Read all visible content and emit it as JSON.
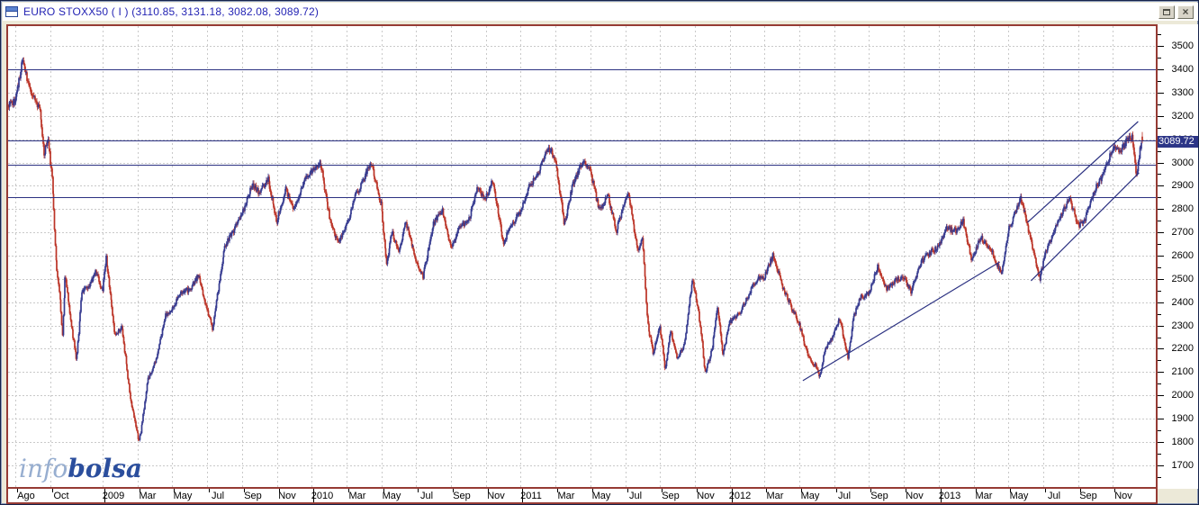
{
  "window": {
    "title": "EURO STOXX50 ( I ) (3110.85, 3131.18, 3082.08, 3089.72)",
    "restore_button": "restore",
    "close_button": "close"
  },
  "watermark": {
    "info": "info",
    "bolsa": "bolsa"
  },
  "price_tag": {
    "value": "3089.72"
  },
  "chart_data": {
    "type": "ohlc-candlestick",
    "title": "EURO STOXX50 ( I ) daily",
    "last_bar": {
      "open": 3110.85,
      "high": 3131.18,
      "low": 3082.08,
      "close": 3089.72
    },
    "y_axis": {
      "tick_labels": [
        3500,
        3400,
        3300,
        3200,
        3100,
        3000,
        2900,
        2800,
        2700,
        2600,
        2500,
        2400,
        2300,
        2200,
        2100,
        2000,
        1900,
        1800,
        1700
      ],
      "minor_step": 50,
      "price_min": 1610,
      "price_max": 3585
    },
    "x_axis": {
      "start_month": "2008-08",
      "end_month": "2013-12",
      "labels": [
        {
          "label": "Ago",
          "t": 0.5,
          "year": false
        },
        {
          "label": "Oct",
          "t": 2.5,
          "year": false
        },
        {
          "label": "2009",
          "t": 5.5,
          "year": true
        },
        {
          "label": "Mar",
          "t": 7.5,
          "year": false
        },
        {
          "label": "May",
          "t": 9.5,
          "year": false
        },
        {
          "label": "Jul",
          "t": 11.5,
          "year": false
        },
        {
          "label": "Sep",
          "t": 13.5,
          "year": false
        },
        {
          "label": "Nov",
          "t": 15.5,
          "year": false
        },
        {
          "label": "2010",
          "t": 17.5,
          "year": true
        },
        {
          "label": "Mar",
          "t": 19.5,
          "year": false
        },
        {
          "label": "May",
          "t": 21.5,
          "year": false
        },
        {
          "label": "Jul",
          "t": 23.5,
          "year": false
        },
        {
          "label": "Sep",
          "t": 25.5,
          "year": false
        },
        {
          "label": "Nov",
          "t": 27.5,
          "year": false
        },
        {
          "label": "2011",
          "t": 29.5,
          "year": true
        },
        {
          "label": "Mar",
          "t": 31.5,
          "year": false
        },
        {
          "label": "May",
          "t": 33.5,
          "year": false
        },
        {
          "label": "Jul",
          "t": 35.5,
          "year": false
        },
        {
          "label": "Sep",
          "t": 37.5,
          "year": false
        },
        {
          "label": "Nov",
          "t": 39.5,
          "year": false
        },
        {
          "label": "2012",
          "t": 41.5,
          "year": true
        },
        {
          "label": "Mar",
          "t": 43.5,
          "year": false
        },
        {
          "label": "May",
          "t": 45.5,
          "year": false
        },
        {
          "label": "Jul",
          "t": 47.5,
          "year": false
        },
        {
          "label": "Sep",
          "t": 49.5,
          "year": false
        },
        {
          "label": "Nov",
          "t": 51.5,
          "year": false
        },
        {
          "label": "2013",
          "t": 53.5,
          "year": true
        },
        {
          "label": "Mar",
          "t": 55.5,
          "year": false
        },
        {
          "label": "May",
          "t": 57.5,
          "year": false
        },
        {
          "label": "Jul",
          "t": 59.5,
          "year": false
        },
        {
          "label": "Sep",
          "t": 61.5,
          "year": false
        },
        {
          "label": "Nov",
          "t": 63.5,
          "year": false
        }
      ]
    },
    "horizontal_levels": [
      3400,
      3095,
      2990,
      2850
    ],
    "trendlines": [
      {
        "t1": 45.2,
        "p1": 2063,
        "t2": 56.5,
        "p2": 2573
      },
      {
        "t1": 58.3,
        "p1": 2492,
        "t2": 64.5,
        "p2": 2956
      },
      {
        "t1": 58.1,
        "p1": 2743,
        "t2": 64.45,
        "p2": 3176
      }
    ],
    "trajectory_approx_closes": [
      [
        -0.45,
        3240
      ],
      [
        0,
        3265
      ],
      [
        0.4,
        3445
      ],
      [
        0.7,
        3345
      ],
      [
        1.1,
        3270
      ],
      [
        1.4,
        3235
      ],
      [
        1.65,
        3025
      ],
      [
        1.85,
        3115
      ],
      [
        2.1,
        2930
      ],
      [
        2.35,
        2545
      ],
      [
        2.55,
        2425
      ],
      [
        2.7,
        2255
      ],
      [
        2.85,
        2530
      ],
      [
        3.1,
        2355
      ],
      [
        3.5,
        2155
      ],
      [
        3.8,
        2440
      ],
      [
        4.2,
        2470
      ],
      [
        4.6,
        2530
      ],
      [
        5,
        2445
      ],
      [
        5.2,
        2590
      ],
      [
        5.7,
        2255
      ],
      [
        6.1,
        2290
      ],
      [
        6.6,
        1985
      ],
      [
        7.1,
        1800
      ],
      [
        7.3,
        1900
      ],
      [
        7.6,
        2070
      ],
      [
        8.1,
        2160
      ],
      [
        8.6,
        2340
      ],
      [
        9,
        2375
      ],
      [
        9.5,
        2445
      ],
      [
        10,
        2455
      ],
      [
        10.5,
        2515
      ],
      [
        10.9,
        2395
      ],
      [
        11.3,
        2285
      ],
      [
        12,
        2640
      ],
      [
        12.5,
        2705
      ],
      [
        13,
        2780
      ],
      [
        13.6,
        2905
      ],
      [
        14,
        2870
      ],
      [
        14.5,
        2930
      ],
      [
        15,
        2745
      ],
      [
        15.5,
        2885
      ],
      [
        16,
        2800
      ],
      [
        16.5,
        2915
      ],
      [
        17,
        2965
      ],
      [
        17.5,
        3005
      ],
      [
        18,
        2775
      ],
      [
        18.5,
        2650
      ],
      [
        19,
        2730
      ],
      [
        19.5,
        2855
      ],
      [
        20,
        2930
      ],
      [
        20.4,
        3005
      ],
      [
        21,
        2815
      ],
      [
        21.3,
        2555
      ],
      [
        21.6,
        2700
      ],
      [
        22,
        2610
      ],
      [
        22.4,
        2745
      ],
      [
        23,
        2575
      ],
      [
        23.4,
        2510
      ],
      [
        24,
        2740
      ],
      [
        24.5,
        2795
      ],
      [
        25,
        2625
      ],
      [
        25.5,
        2725
      ],
      [
        26,
        2745
      ],
      [
        26.5,
        2885
      ],
      [
        27,
        2845
      ],
      [
        27.4,
        2925
      ],
      [
        28,
        2655
      ],
      [
        28.5,
        2735
      ],
      [
        29,
        2795
      ],
      [
        29.5,
        2895
      ],
      [
        30,
        2955
      ],
      [
        30.6,
        3065
      ],
      [
        31,
        3015
      ],
      [
        31.5,
        2735
      ],
      [
        32,
        2910
      ],
      [
        32.6,
        3010
      ],
      [
        33,
        2965
      ],
      [
        33.5,
        2795
      ],
      [
        34,
        2860
      ],
      [
        34.5,
        2705
      ],
      [
        35,
        2845
      ],
      [
        35.2,
        2870
      ],
      [
        35.7,
        2625
      ],
      [
        36,
        2670
      ],
      [
        36.3,
        2305
      ],
      [
        36.6,
        2180
      ],
      [
        37,
        2300
      ],
      [
        37.3,
        2105
      ],
      [
        37.6,
        2275
      ],
      [
        38,
        2160
      ],
      [
        38.4,
        2215
      ],
      [
        38.85,
        2505
      ],
      [
        39.2,
        2370
      ],
      [
        39.6,
        2095
      ],
      [
        40,
        2205
      ],
      [
        40.3,
        2385
      ],
      [
        40.6,
        2175
      ],
      [
        41,
        2315
      ],
      [
        41.5,
        2345
      ],
      [
        42,
        2415
      ],
      [
        42.5,
        2495
      ],
      [
        43,
        2510
      ],
      [
        43.5,
        2605
      ],
      [
        44,
        2475
      ],
      [
        44.5,
        2385
      ],
      [
        45,
        2305
      ],
      [
        45.5,
        2165
      ],
      [
        46,
        2120
      ],
      [
        46.15,
        2075
      ],
      [
        46.5,
        2200
      ],
      [
        47,
        2265
      ],
      [
        47.3,
        2330
      ],
      [
        47.8,
        2160
      ],
      [
        48.1,
        2330
      ],
      [
        48.5,
        2420
      ],
      [
        49,
        2440
      ],
      [
        49.5,
        2555
      ],
      [
        50,
        2455
      ],
      [
        50.5,
        2495
      ],
      [
        51,
        2505
      ],
      [
        51.4,
        2445
      ],
      [
        52,
        2575
      ],
      [
        52.5,
        2615
      ],
      [
        53,
        2635
      ],
      [
        53.4,
        2720
      ],
      [
        54,
        2705
      ],
      [
        54.4,
        2750
      ],
      [
        54.9,
        2575
      ],
      [
        55.4,
        2680
      ],
      [
        56,
        2625
      ],
      [
        56.6,
        2520
      ],
      [
        57,
        2710
      ],
      [
        57.7,
        2845
      ],
      [
        58,
        2765
      ],
      [
        58.8,
        2500
      ],
      [
        59.1,
        2605
      ],
      [
        59.6,
        2705
      ],
      [
        60,
        2765
      ],
      [
        60.5,
        2850
      ],
      [
        61,
        2725
      ],
      [
        61.4,
        2760
      ],
      [
        62,
        2890
      ],
      [
        62.5,
        2955
      ],
      [
        63,
        3065
      ],
      [
        63.4,
        3045
      ],
      [
        63.8,
        3095
      ],
      [
        64.1,
        3110
      ],
      [
        64.35,
        2935
      ],
      [
        64.55,
        3060
      ],
      [
        64.7,
        3089.72
      ]
    ]
  },
  "colors": {
    "up_candle": "#34398f",
    "down_candle": "#bb3326",
    "annotation_line": "#2c3282",
    "grid": "#c9c9c9",
    "tag_bg": "#2c3587",
    "plot_border": "#963b34",
    "window_bg": "#ece9d8",
    "title_text": "#2424b4",
    "logo_info": "#97aed0",
    "logo_bolsa": "#2b4e9d"
  }
}
